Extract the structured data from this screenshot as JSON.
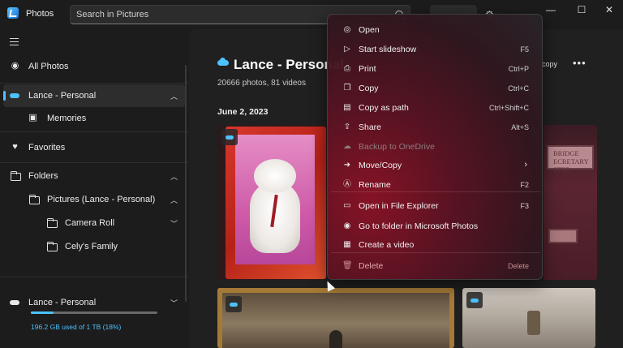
{
  "app": {
    "title": "Photos"
  },
  "search": {
    "placeholder": "Search in Pictures"
  },
  "window_controls": {
    "minimize": "—",
    "maximize": "☐",
    "close": "✕"
  },
  "sidebar": {
    "all_photos": "All Photos",
    "onedrive_account": "Lance - Personal",
    "memories": "Memories",
    "favorites": "Favorites",
    "folders": "Folders",
    "pictures_folder": "Pictures (Lance - Personal)",
    "camera_roll": "Camera Roll",
    "celys_family": "Cely's Family",
    "storage_account": "Lance - Personal",
    "storage_text": "196.2 GB used of 1 TB (18%)",
    "storage_fraction": 0.18
  },
  "main": {
    "album_title": "Lance - Personal",
    "album_subtitle": "20666 photos, 81 videos",
    "date_group": "June 2, 2023",
    "copy_link": "copy",
    "more": "•••",
    "sign_text": "BRIDGE\nECRETARY\nSTER"
  },
  "context_menu": {
    "items": [
      {
        "label": "Open",
        "shortcut": "",
        "icon": "eye-icon"
      },
      {
        "label": "Start slideshow",
        "shortcut": "F5",
        "icon": "slideshow-icon"
      },
      {
        "label": "Print",
        "shortcut": "Ctrl+P",
        "icon": "printer-icon"
      },
      {
        "label": "Copy",
        "shortcut": "Ctrl+C",
        "icon": "copy-icon"
      },
      {
        "label": "Copy as path",
        "shortcut": "Ctrl+Shift+C",
        "icon": "copy-path-icon"
      },
      {
        "label": "Share",
        "shortcut": "Alt+S",
        "icon": "share-icon"
      },
      {
        "label": "Backup to OneDrive",
        "shortcut": "",
        "icon": "cloud-icon",
        "disabled": true
      },
      {
        "label": "Move/Copy",
        "shortcut": "",
        "icon": "move-icon",
        "submenu": true
      },
      {
        "label": "Rename",
        "shortcut": "F2",
        "icon": "rename-icon"
      },
      {
        "label": "Open in File Explorer",
        "shortcut": "F3",
        "icon": "folder-open-icon"
      },
      {
        "label": "Go to folder in Microsoft Photos",
        "shortcut": "",
        "icon": "eye-folder-icon"
      },
      {
        "label": "Create a video",
        "shortcut": "",
        "icon": "video-icon"
      },
      {
        "label": "Delete",
        "shortcut": "Delete",
        "icon": "trash-icon",
        "danger": true
      }
    ]
  },
  "colors": {
    "accent": "#4cc2ff",
    "menu_tint": "#8c1226"
  }
}
